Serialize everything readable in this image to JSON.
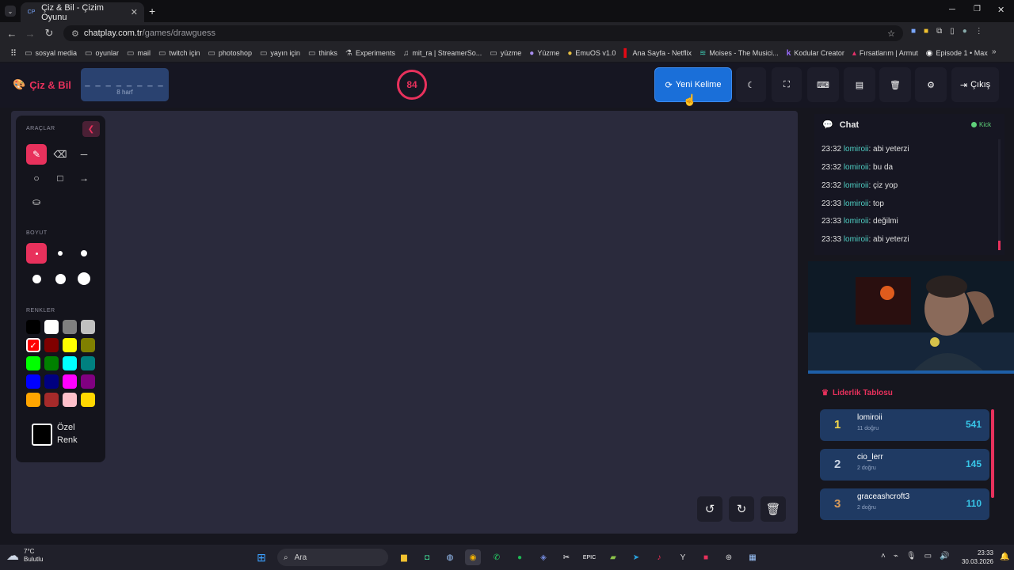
{
  "browser": {
    "tab_title": "Çiz & Bil - Çizim Oyunu",
    "tab_favicon": "CP",
    "url_domain": "chatplay.com.tr",
    "url_path": "/games/drawguess",
    "bookmarks": [
      {
        "icon": "folder-icon",
        "label": "sosyal media"
      },
      {
        "icon": "folder-icon",
        "label": "oyunlar"
      },
      {
        "icon": "folder-icon",
        "label": "mail"
      },
      {
        "icon": "folder-icon",
        "label": "twitch için"
      },
      {
        "icon": "folder-icon",
        "label": "photoshop"
      },
      {
        "icon": "folder-icon",
        "label": "yayın için"
      },
      {
        "icon": "folder-icon",
        "label": "thinks"
      },
      {
        "icon": "flask-icon",
        "label": "Experiments"
      },
      {
        "icon": "music-icon",
        "label": "mit_ra | StreamerSo..."
      },
      {
        "icon": "folder-icon",
        "label": "yüzme"
      },
      {
        "icon": "site-icon",
        "label": "Yüzme"
      },
      {
        "icon": "site-icon",
        "label": "EmuOS v1.0"
      },
      {
        "icon": "netflix-icon",
        "label": "Ana Sayfa - Netflix"
      },
      {
        "icon": "moises-icon",
        "label": "Moises - The Musici..."
      },
      {
        "icon": "k-icon",
        "label": "Kodular Creator"
      },
      {
        "icon": "site-icon",
        "label": "Fırsatlarım | Armut"
      },
      {
        "icon": "max-icon",
        "label": "Episode 1 • Max"
      }
    ]
  },
  "game": {
    "logo": "Çiz & Bil",
    "word_mask": "_ _ _ _ _ _ _ _",
    "word_length": "8 harf",
    "timer": "84",
    "new_word_label": "Yeni Kelime",
    "exit_label": "Çıkış"
  },
  "tools": {
    "tools_title": "ARAÇLAR",
    "size_title": "BOYUT",
    "colors_title": "RENKLER",
    "custom_color_label": "Özel Renk",
    "colors": [
      "#000000",
      "#ffffff",
      "#808080",
      "#c0c0c0",
      "#ff0000",
      "#800000",
      "#ffff00",
      "#808000",
      "#00ff00",
      "#008000",
      "#00ffff",
      "#008080",
      "#0000ff",
      "#000080",
      "#ff00ff",
      "#800080",
      "#ffa500",
      "#a52a2a",
      "#ffc0cb",
      "#ffd700"
    ],
    "selected_color": "#ff0000"
  },
  "chat": {
    "title": "Chat",
    "platform": "Kick",
    "messages": [
      {
        "time": "23:32",
        "user": "lomiroii",
        "text": ": abi yeterzi"
      },
      {
        "time": "23:32",
        "user": "lomiroii",
        "text": ": bu da"
      },
      {
        "time": "23:32",
        "user": "lomiroii",
        "text": ": çiz yop"
      },
      {
        "time": "23:33",
        "user": "lomiroii",
        "text": ": top"
      },
      {
        "time": "23:33",
        "user": "lomiroii",
        "text": ": değilmi"
      },
      {
        "time": "23:33",
        "user": "lomiroii",
        "text": ": abi yeterzi"
      }
    ]
  },
  "leaderboard": {
    "title": "Liderlik Tablosu",
    "rows": [
      {
        "rank": "1",
        "name": "lomiroii",
        "correct": "11 doğru",
        "score": "541",
        "rank_color": "#f5d84a"
      },
      {
        "rank": "2",
        "name": "cio_lerr",
        "correct": "2 doğru",
        "score": "145",
        "rank_color": "#c9d3e3"
      },
      {
        "rank": "3",
        "name": "graceashcroft3",
        "correct": "2 doğru",
        "score": "110",
        "rank_color": "#d89a5a"
      }
    ]
  },
  "taskbar": {
    "temperature": "7°C",
    "weather": "Bulutlu",
    "search_placeholder": "Ara",
    "time": "23:33",
    "date": "30.03.2026"
  }
}
